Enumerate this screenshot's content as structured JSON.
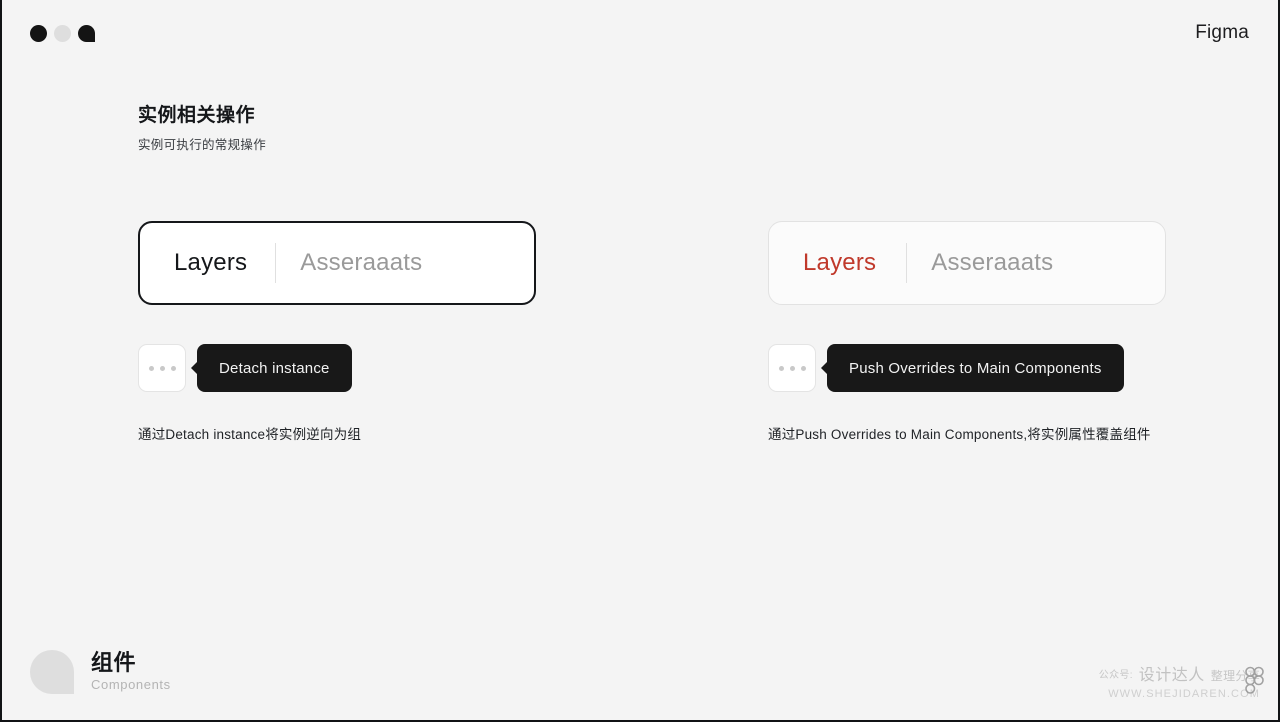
{
  "window": {
    "controls": [
      {
        "name": "dot-dark",
        "color": "#141414"
      },
      {
        "name": "dot-light",
        "color": "#dedede"
      },
      {
        "name": "dot-teardrop",
        "color": "#141414"
      }
    ],
    "brand": "Figma"
  },
  "section": {
    "title": "实例相关操作",
    "subtitle": "实例可执行的常规操作"
  },
  "columns": [
    {
      "tab_card": {
        "style": "emphasis",
        "active_label": "Layers",
        "active_color": "#15171a",
        "inactive_label": "Asseraaats",
        "inactive_color": "#9a9a9a"
      },
      "menu_button": {
        "icon": "ellipsis-icon",
        "dots": 3
      },
      "tooltip": {
        "text": "Detach instance",
        "background": "#181818",
        "text_color": "#f2f2f2"
      },
      "caption": "通过Detach instance将实例逆向为组"
    },
    {
      "tab_card": {
        "style": "plain",
        "active_label": "Layers",
        "active_color": "#c0392b",
        "inactive_label": "Asseraaats",
        "inactive_color": "#9a9a9a"
      },
      "menu_button": {
        "icon": "ellipsis-icon",
        "dots": 3
      },
      "tooltip": {
        "text": "Push Overrides to Main Components",
        "background": "#181818",
        "text_color": "#f2f2f2"
      },
      "caption": "通过Push Overrides to Main Components,将实例属性覆盖组件"
    }
  ],
  "footer": {
    "title": "组件",
    "subtitle": "Components"
  },
  "watermark": {
    "prefix": "公众号:",
    "account": "设计达人",
    "suffix": "整理分享",
    "url": "WWW.SHEJIDAREN.COM"
  }
}
